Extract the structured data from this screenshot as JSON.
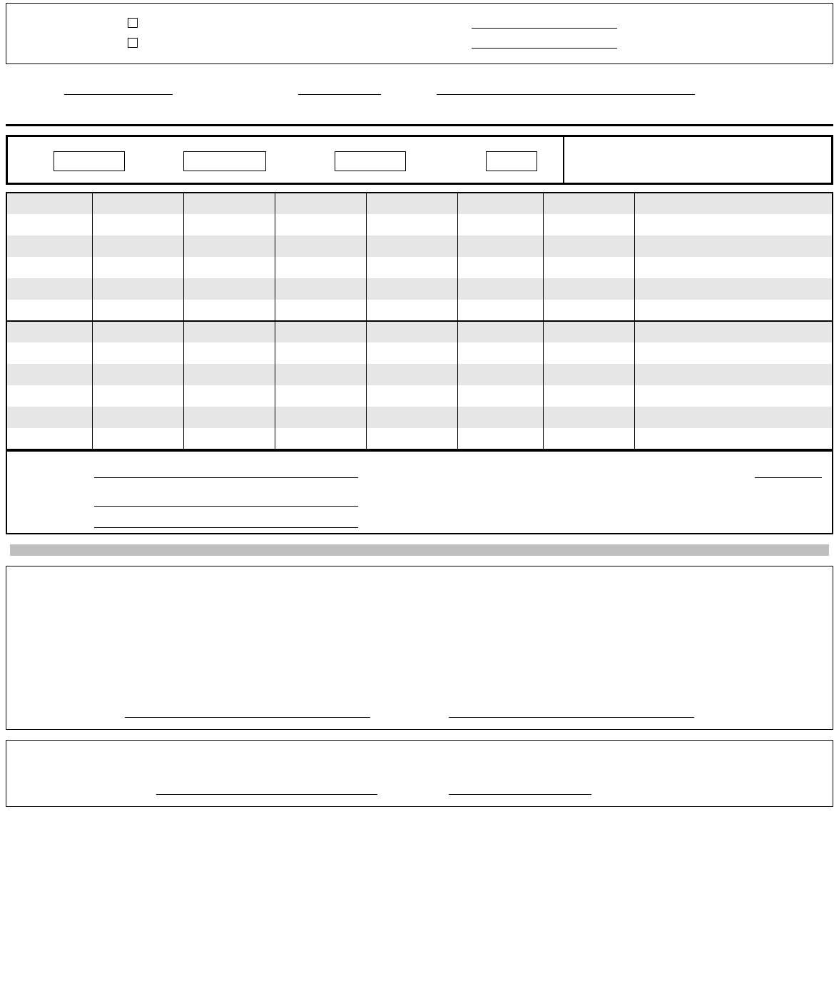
{
  "topBox": {
    "checkbox1": "",
    "checkbox2": "",
    "topField1": "",
    "topField2": ""
  },
  "underRow": {
    "field1": "",
    "field2": "",
    "field3": ""
  },
  "headerBar": {
    "box1": "",
    "box2": "",
    "box3": "",
    "box4": "",
    "rightCell": ""
  },
  "table": {
    "rows": [
      [
        "",
        "",
        "",
        "",
        "",
        "",
        "",
        ""
      ],
      [
        "",
        "",
        "",
        "",
        "",
        "",
        "",
        ""
      ],
      [
        "",
        "",
        "",
        "",
        "",
        "",
        "",
        ""
      ],
      [
        "",
        "",
        "",
        "",
        "",
        "",
        "",
        ""
      ],
      [
        "",
        "",
        "",
        "",
        "",
        "",
        "",
        ""
      ],
      [
        "",
        "",
        "",
        "",
        "",
        "",
        "",
        ""
      ],
      [
        "",
        "",
        "",
        "",
        "",
        "",
        "",
        ""
      ],
      [
        "",
        "",
        "",
        "",
        "",
        "",
        "",
        ""
      ],
      [
        "",
        "",
        "",
        "",
        "",
        "",
        "",
        ""
      ],
      [
        "",
        "",
        "",
        "",
        "",
        "",
        "",
        ""
      ],
      [
        "",
        "",
        "",
        "",
        "",
        "",
        "",
        ""
      ],
      [
        "",
        "",
        "",
        "",
        "",
        "",
        "",
        ""
      ]
    ]
  },
  "tableFooter": {
    "line1": "",
    "line2": "",
    "line3": "",
    "rightField": ""
  },
  "lowerBox1": {
    "signature1": "",
    "signature2": ""
  },
  "lowerBox2": {
    "signature": "",
    "date": ""
  }
}
